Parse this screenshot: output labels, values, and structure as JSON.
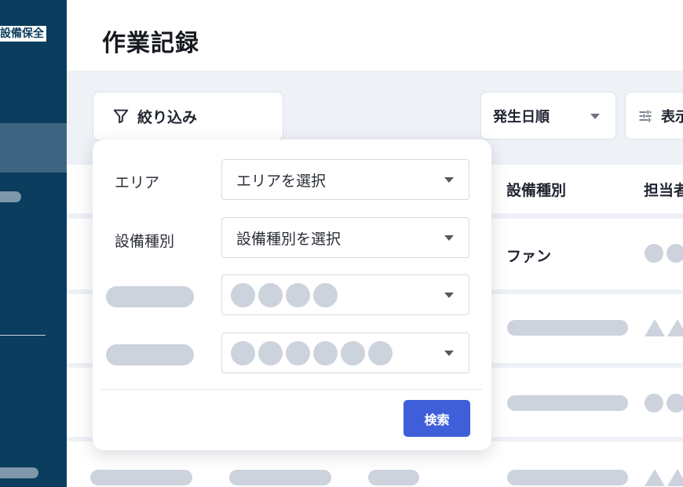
{
  "sidebar": {
    "brand": "設備保全"
  },
  "header": {
    "title": "作業記録"
  },
  "toolbar": {
    "filter_label": "絞り込み",
    "sort_label": "発生日順",
    "display_label": "表示"
  },
  "table": {
    "headers": {
      "equipment_type": "設備種別",
      "assignee": "担当者"
    },
    "first_row": {
      "equipment_type": "ファン"
    }
  },
  "filter_panel": {
    "fields": [
      {
        "label": "エリア",
        "placeholder": "エリアを選択"
      },
      {
        "label": "設備種別",
        "placeholder": "設備種別を選択"
      }
    ],
    "search_label": "検索"
  },
  "colors": {
    "sidebar": "#0a3d5e",
    "primary": "#3f5ed9",
    "placeholder": "#cdd3dc",
    "background": "#eef1f6"
  }
}
